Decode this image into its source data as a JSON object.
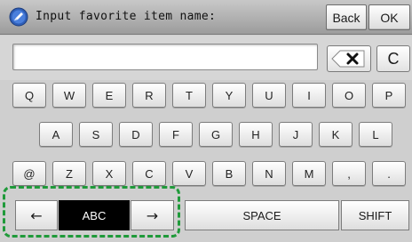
{
  "header": {
    "title": "Input favorite item name:",
    "back_label": "Back",
    "ok_label": "OK",
    "icon": "pencil-icon"
  },
  "input": {
    "value": "",
    "backspace_icon": "backspace-x-icon",
    "clear_label": "C"
  },
  "keyboard": {
    "row1": [
      "Q",
      "W",
      "E",
      "R",
      "T",
      "Y",
      "U",
      "I",
      "O",
      "P"
    ],
    "row2": [
      "A",
      "S",
      "D",
      "F",
      "G",
      "H",
      "J",
      "K",
      "L"
    ],
    "row3": [
      "@",
      "Z",
      "X",
      "C",
      "V",
      "B",
      "N",
      "M",
      ",",
      "."
    ],
    "mode": {
      "left_arrow": "←",
      "current": "ABC",
      "right_arrow": "→"
    },
    "space_label": "SPACE",
    "shift_label": "SHIFT"
  },
  "colors": {
    "highlight_frame": "#1f9a3a",
    "mode_active_bg": "#000000",
    "header_bg": "#b0b0b0"
  }
}
